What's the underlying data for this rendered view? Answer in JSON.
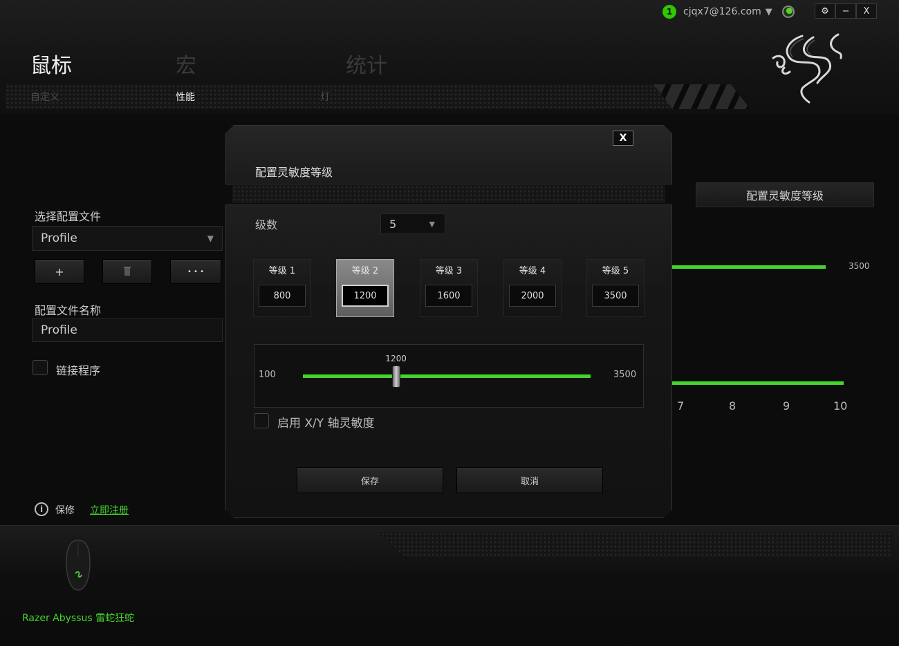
{
  "window": {
    "user_badge": "1",
    "user": "cjqx7@126.com",
    "settings_label": "⚙",
    "minimize_label": "−",
    "close_label": "X"
  },
  "nav": {
    "main_tabs": [
      {
        "label": "鼠标",
        "active": true
      },
      {
        "label": "宏",
        "active": false
      },
      {
        "label": "统计",
        "active": false
      }
    ],
    "sub_tabs": [
      {
        "label": "自定义",
        "active": false
      },
      {
        "label": "性能",
        "active": true
      },
      {
        "label": "灯",
        "active": false
      }
    ]
  },
  "profile": {
    "select_label": "选择配置文件",
    "selected": "Profile",
    "add_label": "+",
    "more_label": "• • •",
    "name_label": "配置文件名称",
    "name_value": "Profile",
    "link_program_label": "链接程序"
  },
  "footer": {
    "warranty_label": "保修",
    "register_label": "立即注册",
    "device_name": "Razer Abyssus 雷蛇狂蛇"
  },
  "background_panel": {
    "config_button": "配置灵敏度等级",
    "max_value": "3500",
    "axis_labels": [
      "7",
      "8",
      "9",
      "10"
    ]
  },
  "dialog": {
    "title": "配置灵敏度等级",
    "close_label": "X",
    "levels_label": "级数",
    "levels_value": "5",
    "stages": [
      {
        "name": "等级 1",
        "value": "800"
      },
      {
        "name": "等级 2",
        "value": "1200"
      },
      {
        "name": "等级 3",
        "value": "1600"
      },
      {
        "name": "等级 4",
        "value": "2000"
      },
      {
        "name": "等级 5",
        "value": "3500"
      }
    ],
    "active_stage": 2,
    "slider": {
      "min": "100",
      "max": "3500",
      "current": "1200"
    },
    "xy_label": "启用 X/Y 轴灵敏度",
    "save_label": "保存",
    "cancel_label": "取消"
  },
  "colors": {
    "accent": "#44d62c",
    "background": "#0c0c0c"
  }
}
